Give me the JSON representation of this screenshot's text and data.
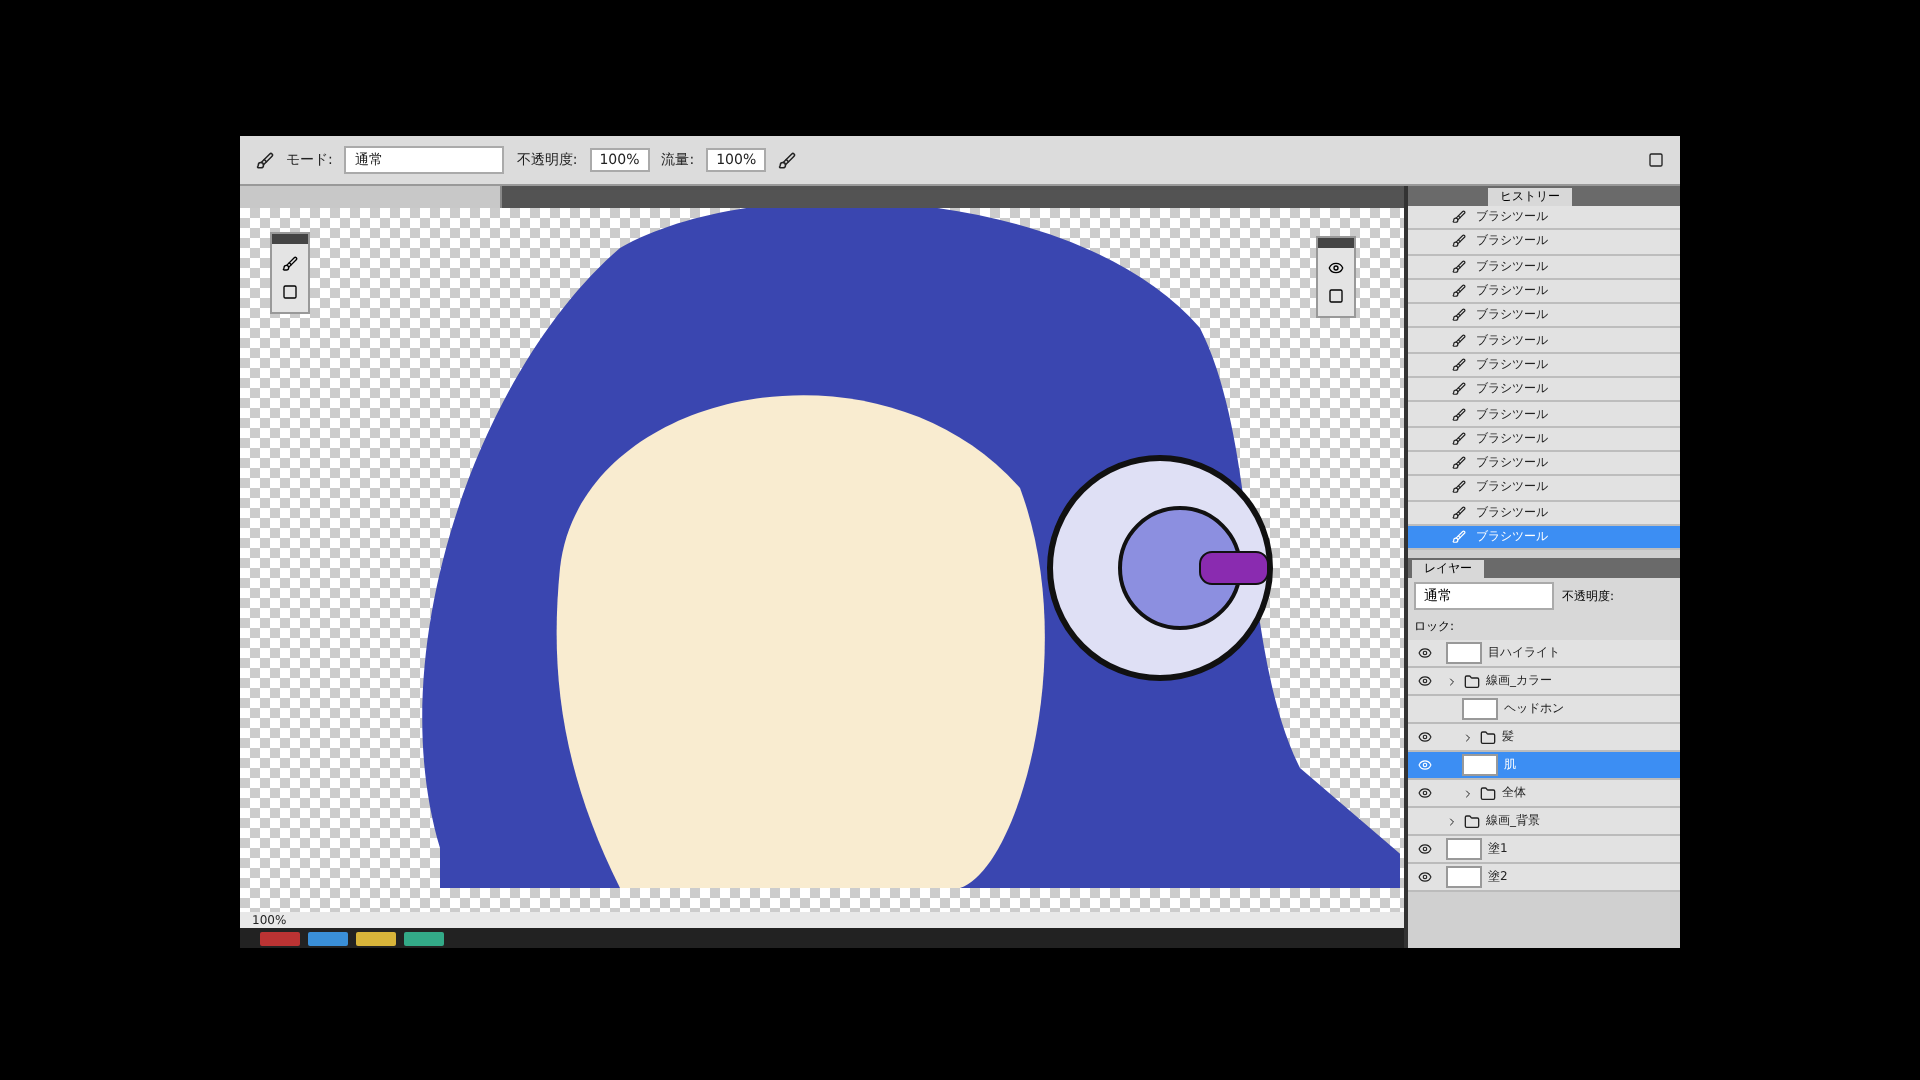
{
  "options_bar": {
    "mode_label": "モード:",
    "mode_value": "通常",
    "opacity_label": "不透明度:",
    "opacity_value": "100%",
    "flow_label": "流量:",
    "flow_value": "100%"
  },
  "history": {
    "tab": "ヒストリー",
    "items": [
      {
        "label": "ブラシツール",
        "selected": false
      },
      {
        "label": "ブラシツール",
        "selected": false
      },
      {
        "label": "ブラシツール",
        "selected": false
      },
      {
        "label": "ブラシツール",
        "selected": false
      },
      {
        "label": "ブラシツール",
        "selected": false
      },
      {
        "label": "ブラシツール",
        "selected": false
      },
      {
        "label": "ブラシツール",
        "selected": false
      },
      {
        "label": "ブラシツール",
        "selected": false
      },
      {
        "label": "ブラシツール",
        "selected": false
      },
      {
        "label": "ブラシツール",
        "selected": false
      },
      {
        "label": "ブラシツール",
        "selected": false
      },
      {
        "label": "ブラシツール",
        "selected": false
      },
      {
        "label": "ブラシツール",
        "selected": false
      },
      {
        "label": "ブラシツール",
        "selected": true
      }
    ]
  },
  "layers": {
    "tab": "レイヤー",
    "blend_mode": "通常",
    "opacity_label": "不透明度:",
    "lock_label": "ロック:",
    "items": [
      {
        "kind": "layer",
        "name": "目ハイライト",
        "visible": true,
        "selected": false
      },
      {
        "kind": "group",
        "name": "線画_カラー",
        "visible": true,
        "selected": false,
        "children": [
          {
            "kind": "layer",
            "name": "ヘッドホン",
            "visible": false,
            "selected": false
          },
          {
            "kind": "group",
            "name": "髪",
            "visible": true,
            "selected": false
          },
          {
            "kind": "layer",
            "name": "肌",
            "visible": true,
            "selected": true
          },
          {
            "kind": "group",
            "name": "全体",
            "visible": true,
            "selected": false
          }
        ]
      },
      {
        "kind": "group",
        "name": "線画_背景",
        "visible": false,
        "selected": false
      },
      {
        "kind": "layer",
        "name": "塗1",
        "visible": true,
        "selected": false
      },
      {
        "kind": "layer",
        "name": "塗2",
        "visible": true,
        "selected": false
      }
    ]
  },
  "status_bar": {
    "zoom": "100%"
  }
}
